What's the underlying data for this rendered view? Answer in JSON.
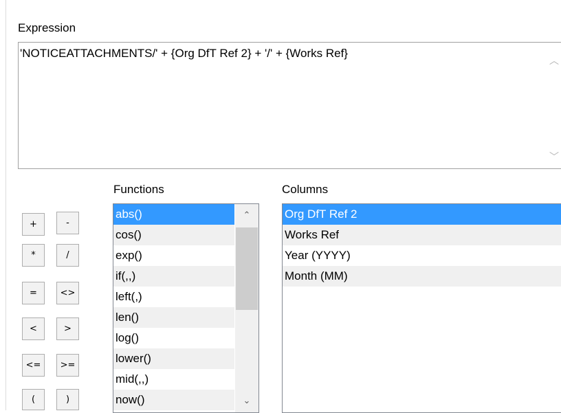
{
  "expression": {
    "label": "Expression",
    "value": "'NOTICEATTACHMENTS/' + {Org DfT Ref 2} + '/' + {Works Ref}"
  },
  "operators": [
    "+",
    "-",
    "*",
    "/",
    "=",
    "<>",
    "<",
    ">",
    "<=",
    ">=",
    "(",
    ")"
  ],
  "functions": {
    "label": "Functions",
    "items": [
      "abs()",
      "cos()",
      "exp()",
      "if(,,)",
      "left(,)",
      "len()",
      "log()",
      "lower()",
      "mid(,,)",
      "now()"
    ],
    "selected": "abs()"
  },
  "columns": {
    "label": "Columns",
    "items": [
      "Org DfT Ref 2",
      "Works Ref",
      "Year (YYYY)",
      "Month (MM)"
    ],
    "selected": "Org DfT Ref 2"
  },
  "icons": {
    "scroll_up": "chevron-up-icon",
    "scroll_down": "chevron-down-icon"
  },
  "colors": {
    "selection": "#3399ff",
    "alt_row": "#f0f0f0",
    "border": "#a0a0a0"
  }
}
